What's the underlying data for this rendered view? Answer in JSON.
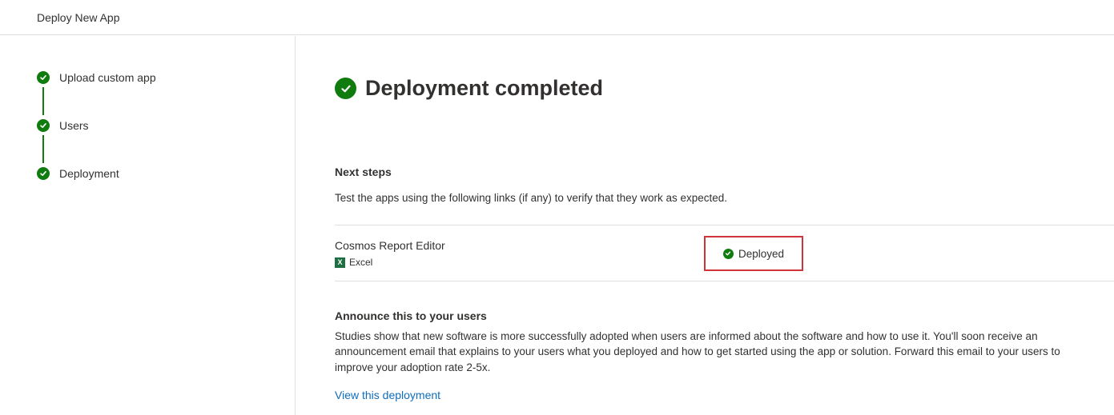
{
  "header": {
    "title": "Deploy New App"
  },
  "wizard": {
    "steps": [
      {
        "label": "Upload custom app",
        "state": "complete"
      },
      {
        "label": "Users",
        "state": "complete"
      },
      {
        "label": "Deployment",
        "state": "complete"
      }
    ]
  },
  "main": {
    "heading": "Deployment completed",
    "next_steps": {
      "title": "Next steps",
      "description": "Test the apps using the following links (if any) to verify that they work as expected."
    },
    "apps": [
      {
        "name": "Cosmos Report Editor",
        "type": "Excel",
        "type_icon": "excel-icon",
        "status": "Deployed"
      }
    ],
    "announce": {
      "title": "Announce this to your users",
      "line1": "Studies show that new software is more successfully adopted when users are informed about the software and how to use it. You'll soon receive an",
      "line2": "announcement email that explains to your users what you deployed and how to get started using the app or solution. Forward this email to your users to",
      "line3": "improve your adoption rate 2-5x."
    },
    "link": "View this deployment"
  },
  "colors": {
    "success": "#107c10",
    "highlight": "#d13438",
    "link": "#0f6cbd",
    "divider": "#e1dfdd"
  }
}
